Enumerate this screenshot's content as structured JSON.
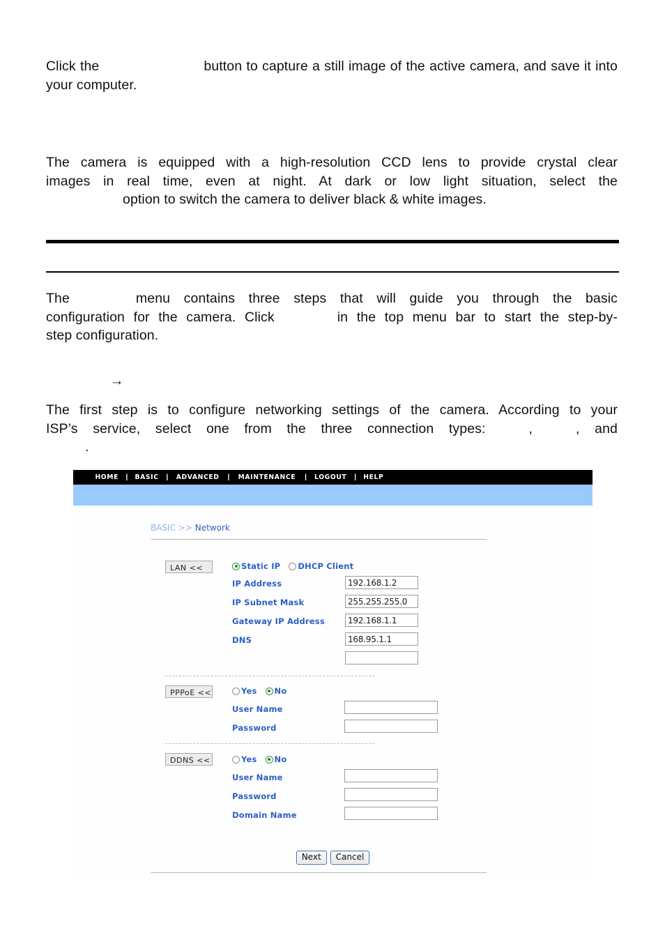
{
  "document": {
    "paragraphs": [
      {
        "id": "snapshot-para",
        "text_before": "Click the",
        "text_after": "button to capture a still image of the active camera, and save it into your computer."
      },
      {
        "id": "ccd-para",
        "line1": "The camera is equipped with a high-resolution CCD lens to provide crystal clear",
        "line2": "images in real time, even at night.   At dark or low light situation, select the",
        "line3": "option to switch the camera to deliver black & white images."
      },
      {
        "id": "basic-menu-para",
        "line1_before": "The",
        "line1_after": "menu contains three steps that will guide you through the basic",
        "line2_before": "configuration for the camera.  Click",
        "line2_after": "in the top menu bar to start the step-by-",
        "line3": "step configuration."
      },
      {
        "id": "network-step-para",
        "line1": "The first step is to configure networking settings of the camera.  According to your",
        "line2_before": "ISP’s service, select one from the three connection types:",
        "line2_mid": ",",
        "line2_after": ", and",
        "line3": "."
      }
    ],
    "arrow_glyph": "→"
  },
  "screenshot": {
    "nav": {
      "separator": "|",
      "items": [
        {
          "label": "HOME"
        },
        {
          "label": "BASIC"
        },
        {
          "label": "ADVANCED"
        },
        {
          "label": "MAINTENANCE"
        },
        {
          "label": "LOGOUT"
        },
        {
          "label": "HELP"
        }
      ]
    },
    "breadcrumb": {
      "parent": "BASIC",
      "separator": " >> ",
      "current": "Network"
    },
    "sections": {
      "lan": {
        "button_label": "LAN <<",
        "radios": [
          {
            "label": "Static IP",
            "checked": true
          },
          {
            "label": "DHCP Client",
            "checked": false
          }
        ],
        "fields": [
          {
            "label": "IP Address",
            "value": "192.168.1.2"
          },
          {
            "label": "IP Subnet Mask",
            "value": "255.255.255.0"
          },
          {
            "label": "Gateway IP Address",
            "value": "192.168.1.1"
          },
          {
            "label": "DNS",
            "value": "168.95.1.1"
          },
          {
            "label": "",
            "value": ""
          }
        ]
      },
      "pppoe": {
        "button_label": "PPPoE <<",
        "radios": [
          {
            "label": "Yes",
            "checked": false
          },
          {
            "label": "No",
            "checked": true
          }
        ],
        "fields": [
          {
            "label": "User Name",
            "value": ""
          },
          {
            "label": "Password",
            "value": ""
          }
        ]
      },
      "ddns": {
        "button_label": "DDNS <<",
        "radios": [
          {
            "label": "Yes",
            "checked": false
          },
          {
            "label": "No",
            "checked": true
          }
        ],
        "fields": [
          {
            "label": "User Name",
            "value": ""
          },
          {
            "label": "Password",
            "value": ""
          },
          {
            "label": "Domain Name",
            "value": ""
          }
        ]
      }
    },
    "buttons": {
      "next": "Next",
      "cancel": "Cancel"
    },
    "colors": {
      "nav_bg": "#000000",
      "sub_bar": "#98caff",
      "label_blue": "#2b5fc4",
      "breadcrumb_light": "#8fb6e8",
      "radio_dot": "#1f8a1f"
    }
  }
}
